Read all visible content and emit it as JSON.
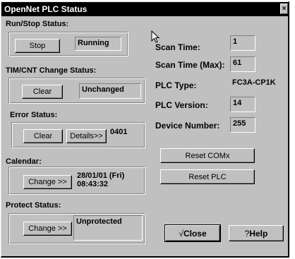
{
  "window": {
    "title": "OpenNet PLC Status",
    "close_glyph": "×"
  },
  "run_stop": {
    "label": "Run/Stop Status:",
    "button": "Stop",
    "value": "Running"
  },
  "tim_cnt": {
    "label": "TIM/CNT Change Status:",
    "button": "Clear",
    "value": "Unchanged"
  },
  "error": {
    "label": "Error Status:",
    "clear_button": "Clear",
    "details_button": "Details>>",
    "value": "0401"
  },
  "calendar": {
    "label": "Calendar:",
    "button": "Change >>",
    "value": "28/01/01 (Fri)\n08:43:32"
  },
  "protect": {
    "label": "Protect Status:",
    "button": "Change >>",
    "value": "Unprotected"
  },
  "info": {
    "scan_time_label": "Scan Time:",
    "scan_time": "1",
    "scan_time_max_label": "Scan Time (Max):",
    "scan_time_max": "61",
    "plc_type_label": "PLC Type:",
    "plc_type": "FC3A-CP1K",
    "plc_version_label": "PLC Version:",
    "plc_version": "14",
    "device_number_label": "Device Number:",
    "device_number": "255"
  },
  "actions": {
    "reset_comx": "Reset COMx",
    "reset_plc": "Reset PLC",
    "close": "Close",
    "close_icon_glyph": "√",
    "help": "Help",
    "help_icon_glyph": "?"
  },
  "colors": {
    "title_bar": "#000000",
    "face": "#c0c0c0",
    "shadow": "#808080",
    "highlight": "#ffffff"
  }
}
